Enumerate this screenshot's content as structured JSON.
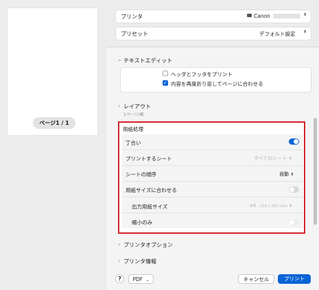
{
  "preview": {
    "page_indicator": "ページ1 / 1"
  },
  "header": {
    "printer_label": "プリンタ",
    "printer_value": "Canon",
    "preset_label": "プリセット",
    "preset_value": "デフォルト設定"
  },
  "text_edit": {
    "title": "テキストエディット",
    "option1": "ヘッダとフッタをプリント",
    "option1_checked": false,
    "option2": "内容を再度折り返してページに合わせる",
    "option2_checked": true
  },
  "layout": {
    "title": "レイアウト",
    "subtitle": "1ページ/枚"
  },
  "paper_handling": {
    "title": "用紙処理",
    "collate_label": "丁合い",
    "collate_on": true,
    "pages_to_print_label": "プリントするシート",
    "pages_to_print_value": "すべてのシート",
    "page_order_label": "シートの順序",
    "page_order_value": "自動",
    "scale_to_fit_label": "用紙サイズに合わせる",
    "scale_to_fit_on": false,
    "dest_paper_label": "出力用紙サイズ",
    "dest_paper_value": "A4",
    "dest_paper_size": "210 x 297 mm",
    "scale_down_only_label": "縮小のみ",
    "scale_down_only_on": false
  },
  "printer_options": {
    "title": "プリンタオプション"
  },
  "printer_info": {
    "title": "プリンタ情報"
  },
  "footer": {
    "help_label": "?",
    "pdf_label": "PDF",
    "cancel_label": "キャンセル",
    "print_label": "プリント"
  },
  "colors": {
    "accent": "#0a64d6",
    "highlight_border": "#d2232a"
  }
}
